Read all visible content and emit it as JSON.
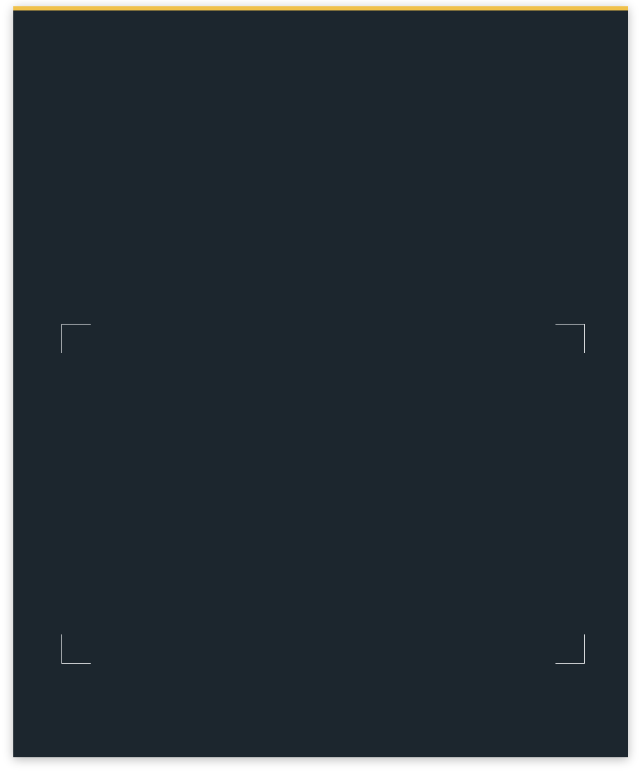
{
  "panel": {
    "background_color": "#1c262e",
    "accent_color": "#f0c14b",
    "frame_color": "#e8eaec"
  },
  "icons": {
    "frame_corners": [
      "corner-top-left-icon",
      "corner-top-right-icon",
      "corner-bottom-left-icon",
      "corner-bottom-right-icon"
    ]
  }
}
